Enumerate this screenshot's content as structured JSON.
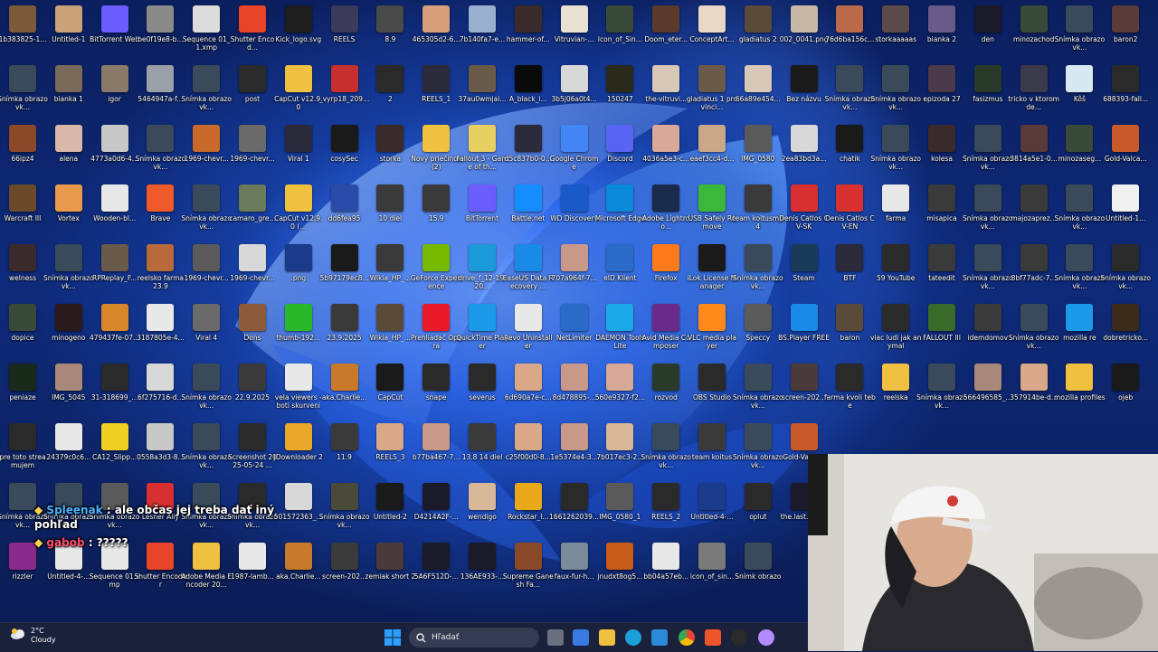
{
  "desktop": {
    "icons": [
      {
        "label": "1b383825-1...",
        "color": "#7a5a3a"
      },
      {
        "label": "Untitled-1",
        "color": "#c9a27a"
      },
      {
        "label": "BitTorrent Web",
        "color": "#6a5cff"
      },
      {
        "label": "be0f19e8-b...",
        "color": "#8a8a8a"
      },
      {
        "label": "Sequence 01_1.xmp",
        "color": "#dcdcdc"
      },
      {
        "label": "Shutter Encod...",
        "color": "#e8442a"
      },
      {
        "label": "Kick_logo.svg",
        "color": "#1e1e1e"
      },
      {
        "label": "REELS",
        "color": "#3a3a5a"
      },
      {
        "label": "8.9",
        "color": "#4a4a4a"
      },
      {
        "label": "465305d2-6...",
        "color": "#d8a07a"
      },
      {
        "label": "7b140fa7-e...",
        "color": "#9ab0d0"
      },
      {
        "label": "hammer-of...",
        "color": "#3a2a2a"
      },
      {
        "label": "Vitruvian-...",
        "color": "#e8e0d0"
      },
      {
        "label": "Icon_of_Sin...",
        "color": "#3a4a3a"
      },
      {
        "label": "Doom_eter...",
        "color": "#5a3a2a"
      },
      {
        "label": "ConceptArt...",
        "color": "#e8d8c8"
      },
      {
        "label": "gladiatus 2",
        "color": "#5a4a3a"
      },
      {
        "label": "002_0041.png",
        "color": "#c8b8a8"
      },
      {
        "label": "76d6ba156c...",
        "color": "#b86a4a"
      },
      {
        "label": "storkaaaaas",
        "color": "#5a4a4a"
      },
      {
        "label": "bianka 2",
        "color": "#6a5a8a"
      },
      {
        "label": "den",
        "color": "#1a1a2a"
      },
      {
        "label": "minozachod",
        "color": "#3a4a3a"
      },
      {
        "label": "Snímka obrazovk...",
        "color": "#3a4a5a"
      },
      {
        "label": "baron2",
        "color": "#5a3a3a"
      },
      {
        "label": "Snímka obrazovk...",
        "color": "#3a4a5a"
      },
      {
        "label": "bianka 1",
        "color": "#7a6a5a"
      },
      {
        "label": "igor",
        "color": "#8a7a6a"
      },
      {
        "label": "5464947a-f...",
        "color": "#9aa0a8"
      },
      {
        "label": "Snímka obrazovk...",
        "color": "#3a4a5a"
      },
      {
        "label": "post",
        "color": "#2a2a2a"
      },
      {
        "label": "CapCut v12.9.0",
        "color": "#f0c040"
      },
      {
        "label": "_vyrp18_209...",
        "color": "#c83030"
      },
      {
        "label": "2",
        "color": "#2a2a2a"
      },
      {
        "label": "REELS_1",
        "color": "#2a2a3a"
      },
      {
        "label": "37au0wmjai...",
        "color": "#6a5a4a"
      },
      {
        "label": "A_black_i...",
        "color": "#0a0a0a"
      },
      {
        "label": "3b5j06a0t4...",
        "color": "#d8d8d8"
      },
      {
        "label": "150247",
        "color": "#2a2a1a"
      },
      {
        "label": "the-vitruvi...",
        "color": "#d8c8b8"
      },
      {
        "label": "gladiatus 1 provinci...",
        "color": "#6a5a4a"
      },
      {
        "label": "66a89e454...",
        "color": "#d8c8b8"
      },
      {
        "label": "Bez názvu",
        "color": "#1a1a1a"
      },
      {
        "label": "Snímka obrazovk...",
        "color": "#3a4a5a"
      },
      {
        "label": "Snímka obrazovk...",
        "color": "#3a4a5a"
      },
      {
        "label": "epizoda 27",
        "color": "#4a3a4a"
      },
      {
        "label": "fasizmus",
        "color": "#2a3a2a"
      },
      {
        "label": "tricko v ktorom de...",
        "color": "#3a3a4a"
      },
      {
        "label": "Kôš",
        "color": "#d8e8f0"
      },
      {
        "label": "688393-fall...",
        "color": "#2a2a2a"
      },
      {
        "label": "66ipz4",
        "color": "#8a4a2a"
      },
      {
        "label": "alena",
        "color": "#d8b8a8"
      },
      {
        "label": "4773a0d6-4...",
        "color": "#c8c8c8"
      },
      {
        "label": "Snímka obrazovk...",
        "color": "#3a4a5a"
      },
      {
        "label": "1969-chevr...",
        "color": "#c86a2a"
      },
      {
        "label": "1969-chevr...",
        "color": "#6a6a6a"
      },
      {
        "label": "Viral 1",
        "color": "#2a2a3a"
      },
      {
        "label": "cosySec",
        "color": "#1a1a1a"
      },
      {
        "label": "storka",
        "color": "#3a2a2a"
      },
      {
        "label": "Nový priečinok (2)",
        "color": "#f0c040"
      },
      {
        "label": "Fallout 3 - Game of th...",
        "color": "#e8d060"
      },
      {
        "label": "d5c837b0-0...",
        "color": "#2a2a3a"
      },
      {
        "label": "Google Chrome",
        "color": "#4285f4"
      },
      {
        "label": "Discord",
        "color": "#5865f2"
      },
      {
        "label": "4036a5e3-c...",
        "color": "#d8a898"
      },
      {
        "label": "eaef3cc4-d...",
        "color": "#c8a888"
      },
      {
        "label": "IMG_0580",
        "color": "#5a5a5a"
      },
      {
        "label": "2ea83bd3a...",
        "color": "#d8d8d8"
      },
      {
        "label": "chatik",
        "color": "#1a1a1a"
      },
      {
        "label": "Snímka obrazovk...",
        "color": "#3a4a5a"
      },
      {
        "label": "kolesa",
        "color": "#3a2a2a"
      },
      {
        "label": "Snímka obrazovk...",
        "color": "#3a4a5a"
      },
      {
        "label": "3814a5e1-0...",
        "color": "#5a3a3a"
      },
      {
        "label": "minozaseg...",
        "color": "#3a4a3a"
      },
      {
        "label": "Gold-Valca...",
        "color": "#c85a2a"
      },
      {
        "label": "Warcraft III",
        "color": "#6a4a2a"
      },
      {
        "label": "Vortex",
        "color": "#e89a4a"
      },
      {
        "label": "Wooden-bl...",
        "color": "#e8e8e8"
      },
      {
        "label": "Brave",
        "color": "#f05a2a"
      },
      {
        "label": "Snímka obrazovk...",
        "color": "#3a4a5a"
      },
      {
        "label": "camaro_gre...",
        "color": "#6a7a5a"
      },
      {
        "label": "CapCut v12.9.0 (...",
        "color": "#f0c040"
      },
      {
        "label": "dd6fea95",
        "color": "#2a4aa8"
      },
      {
        "label": "10 diel",
        "color": "#3a3a3a"
      },
      {
        "label": "15.9",
        "color": "#3a3a3a"
      },
      {
        "label": "BitTorrent",
        "color": "#6a5cff"
      },
      {
        "label": "Battle.net",
        "color": "#148eff"
      },
      {
        "label": "WD Discovery",
        "color": "#1a5ac8"
      },
      {
        "label": "Microsoft Edge",
        "color": "#0a8ad8"
      },
      {
        "label": "Adobe Lightroo...",
        "color": "#1a2a4a"
      },
      {
        "label": "USB Safely Remove",
        "color": "#3ab83a"
      },
      {
        "label": "team koitusmp4",
        "color": "#3a3a3a"
      },
      {
        "label": "Denis Catlos CV-SK",
        "color": "#d83030"
      },
      {
        "label": "Denis Catlos CV-EN",
        "color": "#d83030"
      },
      {
        "label": "farma",
        "color": "#e8e8e8"
      },
      {
        "label": "misapica",
        "color": "#3a3a3a"
      },
      {
        "label": "Snímka obrazovk...",
        "color": "#3a4a5a"
      },
      {
        "label": "majozaprez...",
        "color": "#3a3a3a"
      },
      {
        "label": "Snímka obrazovk...",
        "color": "#3a4a5a"
      },
      {
        "label": "Untitled-1...",
        "color": "#f0f0f0"
      },
      {
        "label": "welness",
        "color": "#3a2a2a"
      },
      {
        "label": "Snímka obrazovk...",
        "color": "#3a4a5a"
      },
      {
        "label": "RPReplay_F...",
        "color": "#6a5a4a"
      },
      {
        "label": "reelsko farma 23.9",
        "color": "#b86a3a"
      },
      {
        "label": "1969-chevr...",
        "color": "#5a5a5a"
      },
      {
        "label": "1969-chevr...",
        "color": "#d8d8d8"
      },
      {
        "label": ".png",
        "color": "#1a3a8a"
      },
      {
        "label": "5b97179ec8...",
        "color": "#1a1a1a"
      },
      {
        "label": "Wikia_HP_...",
        "color": "#3a3a3a"
      },
      {
        "label": "GeForce Experience",
        "color": "#76b900"
      },
      {
        "label": "drive_f_12-19-20...",
        "color": "#1a9ad8"
      },
      {
        "label": "EaseUS Data Recovery ...",
        "color": "#1a8ae8"
      },
      {
        "label": "707a964f-7...",
        "color": "#c89888"
      },
      {
        "label": "eID Klient",
        "color": "#2a6ac8"
      },
      {
        "label": "Firefox",
        "color": "#ff7a1a"
      },
      {
        "label": "iLok License Manager",
        "color": "#1a1a1a"
      },
      {
        "label": "Snímka obrazovk...",
        "color": "#3a4a5a"
      },
      {
        "label": "Steam",
        "color": "#1a3a5a"
      },
      {
        "label": "BTF",
        "color": "#2a2a3a"
      },
      {
        "label": "59 YouTube",
        "color": "#2a2a2a"
      },
      {
        "label": "tateedit",
        "color": "#3a3a3a"
      },
      {
        "label": "Snímka obrazovk...",
        "color": "#3a4a5a"
      },
      {
        "label": "8bf77adc-7...",
        "color": "#3a3a3a"
      },
      {
        "label": "Snímka obrazovk...",
        "color": "#3a4a5a"
      },
      {
        "label": "Snímka obrazovk...",
        "color": "#2a2a2a"
      },
      {
        "label": "dopice",
        "color": "#3a4a3a"
      },
      {
        "label": "minogeno",
        "color": "#2a1a1a"
      },
      {
        "label": "479437fe-07...",
        "color": "#d8882a"
      },
      {
        "label": "3187805e-4...",
        "color": "#e8e8e8"
      },
      {
        "label": "Viral 4",
        "color": "#6a6a6a"
      },
      {
        "label": "Dons",
        "color": "#8a5a3a"
      },
      {
        "label": "thumb-192...",
        "color": "#2ab82a"
      },
      {
        "label": "23.9.2025",
        "color": "#3a3a3a"
      },
      {
        "label": "Wikia_HP_...",
        "color": "#5a4a3a"
      },
      {
        "label": "Prehliadač Opera",
        "color": "#e81a2a"
      },
      {
        "label": "QuickTime Player",
        "color": "#1a9ae8"
      },
      {
        "label": "Revo Uninstaller",
        "color": "#e8e8e8"
      },
      {
        "label": "NetLimiter",
        "color": "#2a6ac8"
      },
      {
        "label": "DAEMON Tools Lite",
        "color": "#1aa8e8"
      },
      {
        "label": "Avid Media Composer",
        "color": "#6a2a8a"
      },
      {
        "label": "VLC media player",
        "color": "#ff8a1a"
      },
      {
        "label": "Speccy",
        "color": "#5a5a5a"
      },
      {
        "label": "BS.Player FREE",
        "color": "#1a8ae8"
      },
      {
        "label": "baron",
        "color": "#5a4a3a"
      },
      {
        "label": "viac ludi jak anymal",
        "color": "#2a2a2a"
      },
      {
        "label": "FALLOUT III",
        "color": "#3a6a2a"
      },
      {
        "label": "idemdomov",
        "color": "#3a3a3a"
      },
      {
        "label": "Snímka obrazovk...",
        "color": "#3a4a5a"
      },
      {
        "label": "mozilla re",
        "color": "#1a9ae8"
      },
      {
        "label": "dobretricko...",
        "color": "#3a2a1a"
      },
      {
        "label": "peniaze",
        "color": "#1a2a1a"
      },
      {
        "label": "IMG_5045",
        "color": "#a88878"
      },
      {
        "label": "31-318699_...",
        "color": "#2a2a2a"
      },
      {
        "label": "6f275716-d...",
        "color": "#d8d8d8"
      },
      {
        "label": "Snímka obrazovk...",
        "color": "#3a4a5a"
      },
      {
        "label": "22.9.2025",
        "color": "#3a3a3a"
      },
      {
        "label": "vela viewers - boti skurveni",
        "color": "#e8e8e8"
      },
      {
        "label": "aka.Charlie...",
        "color": "#c87a2a"
      },
      {
        "label": "CapCut",
        "color": "#1a1a1a"
      },
      {
        "label": "snape",
        "color": "#2a2a2a"
      },
      {
        "label": "severus",
        "color": "#2a2a2a"
      },
      {
        "label": "6d690a7e-c...",
        "color": "#d8a888"
      },
      {
        "label": "8d478895-...",
        "color": "#c89888"
      },
      {
        "label": "560e9327-f2...",
        "color": "#d8a898"
      },
      {
        "label": "rozvod",
        "color": "#2a3a2a"
      },
      {
        "label": "OBS Studio",
        "color": "#2a2a2a"
      },
      {
        "label": "Snímka obrazovk...",
        "color": "#3a4a5a"
      },
      {
        "label": "screen-202...",
        "color": "#4a3a3a"
      },
      {
        "label": "farma kvoli tebe",
        "color": "#2a2a2a"
      },
      {
        "label": "reelska",
        "color": "#f0c040"
      },
      {
        "label": "Snímka obrazovk...",
        "color": "#3a4a5a"
      },
      {
        "label": "566496585_...",
        "color": "#a88878"
      },
      {
        "label": "357914be-d...",
        "color": "#d8a888"
      },
      {
        "label": "mozilla profiles",
        "color": "#f0c040"
      },
      {
        "label": "ojeb",
        "color": "#1a1a1a"
      },
      {
        "label": "pre toto streamujem",
        "color": "#2a2a2a"
      },
      {
        "label": "24379c0c6...",
        "color": "#e8e8e8"
      },
      {
        "label": "CA12_Slipp...",
        "color": "#f0d020"
      },
      {
        "label": "0558a3d3-8...",
        "color": "#c8c8c8"
      },
      {
        "label": "Snímka obrazovk...",
        "color": "#3a4a5a"
      },
      {
        "label": "Screenshot 2025-05-24 ...",
        "color": "#2a2a2a"
      },
      {
        "label": "JDownloader 2",
        "color": "#e8a82a"
      },
      {
        "label": "11.9",
        "color": "#3a3a3a"
      },
      {
        "label": "REELS_3",
        "color": "#d8a888"
      },
      {
        "label": "b77ba467-7...",
        "color": "#c89888"
      },
      {
        "label": "13.8 14 diel",
        "color": "#3a3a3a"
      },
      {
        "label": "c25f00d0-8...",
        "color": "#d8a888"
      },
      {
        "label": "1e5374e4-3...",
        "color": "#c89888"
      },
      {
        "label": "7b017ec3-2...",
        "color": "#d8b898"
      },
      {
        "label": "Snímka obrazovk...",
        "color": "#3a4a5a"
      },
      {
        "label": "team koitus",
        "color": "#3a3a3a"
      },
      {
        "label": "Snímka obrazovk...",
        "color": "#3a4a5a"
      },
      {
        "label": "Gold-Valca...",
        "color": "#c85a2a"
      },
      {
        "label": "Snímka obrazovk...",
        "color": "#3a4a5a"
      },
      {
        "label": "Snímka obrazovk...",
        "color": "#3a4a5a"
      },
      {
        "label": "Snímka obrazovk...",
        "color": "#5a5a5a"
      },
      {
        "label": "Lesner Ally",
        "color": "#d83030"
      },
      {
        "label": "Snímka obrazovk...",
        "color": "#3a4a5a"
      },
      {
        "label": "Snímka obrazovk...",
        "color": "#2a2a2a"
      },
      {
        "label": "501572363_...",
        "color": "#d8d8d8"
      },
      {
        "label": "Snímka obrazovk...",
        "color": "#4a4a3a"
      },
      {
        "label": "Untitled-2",
        "color": "#1a1a1a"
      },
      {
        "label": "D4214A2F-...",
        "color": "#1a1a2a"
      },
      {
        "label": "wendigo",
        "color": "#d8b898"
      },
      {
        "label": "Rockstar_l...",
        "color": "#e8a81a"
      },
      {
        "label": "1661262039...",
        "color": "#2a2a2a"
      },
      {
        "label": "IMG_0580_1",
        "color": "#5a5a5a"
      },
      {
        "label": "REELS_2",
        "color": "#2a2a2a"
      },
      {
        "label": "Untitled-4-...",
        "color": "#1a3a8a"
      },
      {
        "label": "oplut",
        "color": "#2a2a2a"
      },
      {
        "label": "the.last.of.u...",
        "color": "#1a1a2a"
      },
      {
        "label": "rizzler",
        "color": "#8a2a8a"
      },
      {
        "label": "Untitled-4-...",
        "color": "#e8e8e8"
      },
      {
        "label": "Sequence 01.xmp",
        "color": "#e8e8e8"
      },
      {
        "label": "Shutter Encoder",
        "color": "#e8442a"
      },
      {
        "label": "Adobe Media Encoder 20...",
        "color": "#f0c040"
      },
      {
        "label": "1987-lamb...",
        "color": "#e8e8e8"
      },
      {
        "label": "aka.Charlie...",
        "color": "#c87a2a"
      },
      {
        "label": "screen-202...",
        "color": "#3a3a3a"
      },
      {
        "label": "zemiak short 2",
        "color": "#4a3a3a"
      },
      {
        "label": "5A6F512D-...",
        "color": "#1a1a2a"
      },
      {
        "label": "136AE933-...",
        "color": "#1a1a2a"
      },
      {
        "label": "Supreme Ganesh Fa...",
        "color": "#8a4a2a"
      },
      {
        "label": "faux-fur-h...",
        "color": "#7a8a9a"
      },
      {
        "label": "jnudxt8og5...",
        "color": "#c85a1a"
      },
      {
        "label": "bb04a57eb...",
        "color": "#e8e8e8"
      },
      {
        "label": "icon_of_sin...",
        "color": "#7a7a7a"
      },
      {
        "label": "Snímk obrazo",
        "color": "#3a4a5a"
      }
    ]
  },
  "chat": {
    "line1": {
      "user": "Spleenak",
      "text": "ale občas jej treba dať iný pohľad"
    },
    "line2": {
      "user": "gabob",
      "text": "?????"
    }
  },
  "taskbar": {
    "weather_temp": "2°C",
    "weather_desc": "Cloudy",
    "search_placeholder": "Hľadať"
  }
}
